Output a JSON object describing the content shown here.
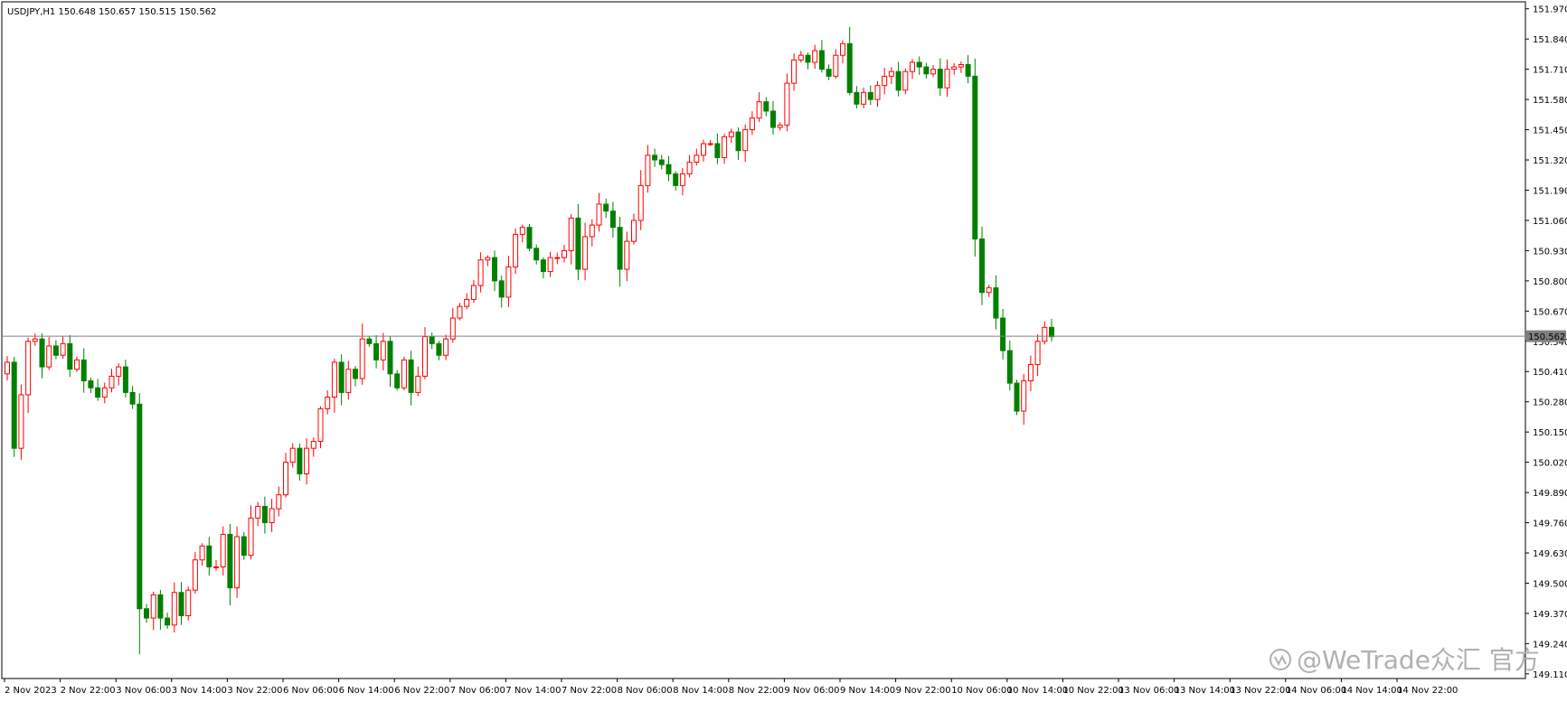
{
  "chart_data": {
    "type": "candlestick",
    "symbol": "USDJPY",
    "timeframe": "H1",
    "header": "USDJPY,H1  150.648 150.657 150.515 150.562",
    "ohlc": {
      "open": 150.648,
      "high": 150.657,
      "low": 150.515,
      "close": 150.562
    },
    "current_price": 150.562,
    "current_price_label": "150.562",
    "ylim": [
      149.09,
      152.0
    ],
    "y_ticks": [
      "151.970",
      "151.840",
      "151.710",
      "151.580",
      "151.450",
      "151.320",
      "151.190",
      "151.060",
      "150.930",
      "150.800",
      "150.670",
      "150.540",
      "150.410",
      "150.280",
      "150.150",
      "150.020",
      "149.890",
      "149.760",
      "149.630",
      "149.500",
      "149.370",
      "149.240",
      "149.110"
    ],
    "x_ticks": [
      "2 Nov 2023",
      "2 Nov 22:00",
      "3 Nov 06:00",
      "3 Nov 14:00",
      "3 Nov 22:00",
      "6 Nov 06:00",
      "6 Nov 14:00",
      "6 Nov 22:00",
      "7 Nov 06:00",
      "7 Nov 14:00",
      "7 Nov 22:00",
      "8 Nov 06:00",
      "8 Nov 14:00",
      "8 Nov 22:00",
      "9 Nov 06:00",
      "9 Nov 14:00",
      "9 Nov 22:00",
      "10 Nov 06:00",
      "10 Nov 14:00",
      "10 Nov 22:00",
      "13 Nov 06:00",
      "13 Nov 14:00",
      "13 Nov 22:00",
      "14 Nov 06:00",
      "14 Nov 14:00",
      "14 Nov 22:00"
    ],
    "closes": [
      150.45,
      150.08,
      150.31,
      150.54,
      150.55,
      150.43,
      150.52,
      150.48,
      150.53,
      150.42,
      150.46,
      150.37,
      150.34,
      150.3,
      150.34,
      150.39,
      150.43,
      150.32,
      150.27,
      149.39,
      149.35,
      149.45,
      149.35,
      149.32,
      149.46,
      149.36,
      149.47,
      149.6,
      149.66,
      149.57,
      149.57,
      149.71,
      149.48,
      149.7,
      149.62,
      149.78,
      149.83,
      149.76,
      149.82,
      149.88,
      150.02,
      150.08,
      149.97,
      150.08,
      150.11,
      150.25,
      150.3,
      150.45,
      150.32,
      150.42,
      150.38,
      150.55,
      150.53,
      150.46,
      150.54,
      150.4,
      150.34,
      150.46,
      150.32,
      150.39,
      150.56,
      150.53,
      150.48,
      150.55,
      150.64,
      150.69,
      150.72,
      150.78,
      150.89,
      150.9,
      150.8,
      150.73,
      150.86,
      151.0,
      151.03,
      150.94,
      150.89,
      150.84,
      150.9,
      150.9,
      150.93,
      151.07,
      150.85,
      150.99,
      151.04,
      151.13,
      151.1,
      151.03,
      150.85,
      150.97,
      151.06,
      151.21,
      151.34,
      151.32,
      151.3,
      151.26,
      151.21,
      151.26,
      151.31,
      151.34,
      151.39,
      151.39,
      151.33,
      151.42,
      151.44,
      151.36,
      151.45,
      151.5,
      151.57,
      151.53,
      151.46,
      151.47,
      151.65,
      151.75,
      151.77,
      151.74,
      151.79,
      151.71,
      151.68,
      151.77,
      151.82,
      151.61,
      151.56,
      151.61,
      151.58,
      151.64,
      151.68,
      151.7,
      151.62,
      151.7,
      151.74,
      151.72,
      151.69,
      151.71,
      151.63,
      151.71,
      151.72,
      151.73,
      151.68,
      150.98,
      150.75,
      150.77,
      150.64,
      150.5,
      150.36,
      150.24,
      150.37,
      150.44,
      150.54,
      150.6,
      150.56
    ]
  },
  "watermark": {
    "text": "@WeTrade众汇 官方",
    "icon": "wechat-channels-icon"
  },
  "colors": {
    "bull": "#ff0000",
    "bear": "#008000",
    "grid_line": "#808080",
    "price_tag_bg": "#808080",
    "price_tag_text": "#ffffff",
    "text": "#000000",
    "border": "#000000",
    "background": "#ffffff",
    "watermark": "#b0b0b0"
  }
}
